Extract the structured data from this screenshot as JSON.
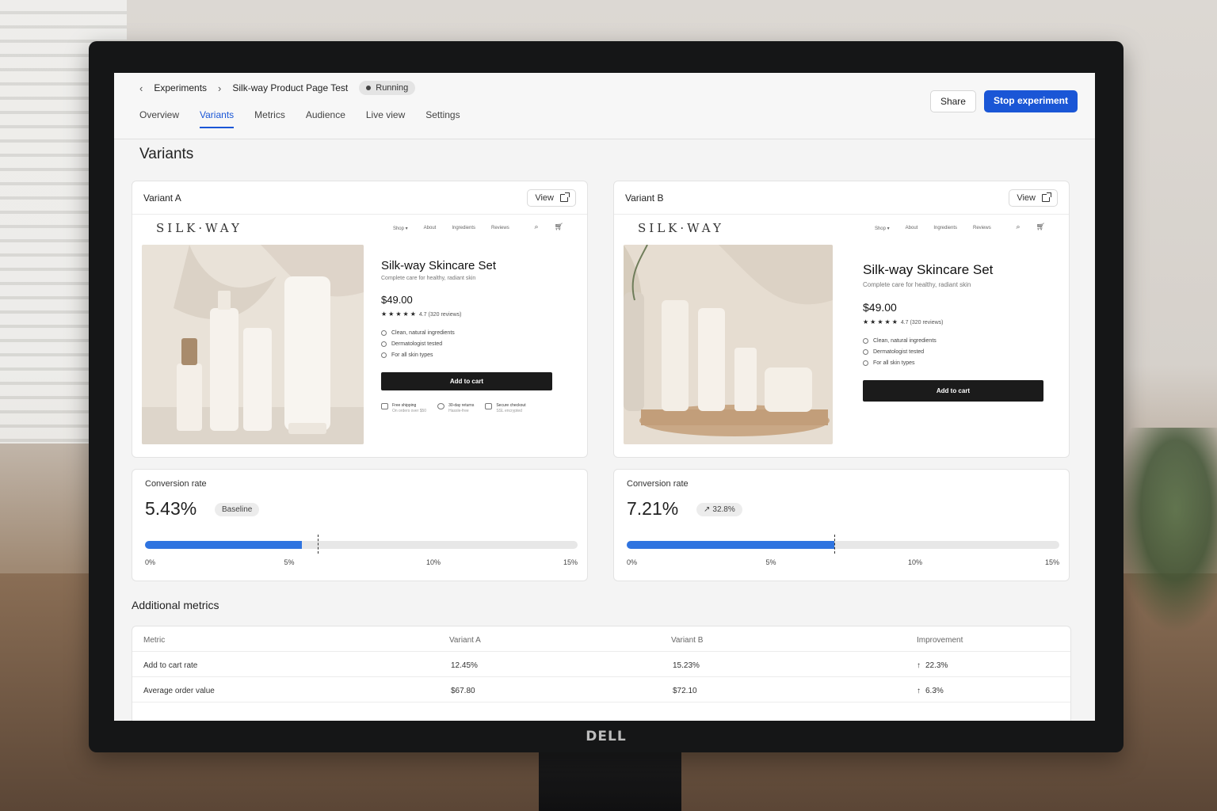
{
  "breadcrumb": {
    "parent": "Experiments",
    "current": "Silk-way Product Page Test",
    "status": "Running"
  },
  "tabs": [
    {
      "label": "Overview"
    },
    {
      "label": "Variants"
    },
    {
      "label": "Metrics"
    },
    {
      "label": "Audience"
    },
    {
      "label": "Live view"
    },
    {
      "label": "Settings"
    }
  ],
  "active_tab": "Variants",
  "actions": {
    "share": "Share",
    "stop": "Stop experiment"
  },
  "page_title": "Variants",
  "variants": [
    {
      "name": "Variant A",
      "view_label": "View",
      "site": {
        "logo": "SILK·WAY",
        "nav": [
          "Shop ▾",
          "About",
          "Ingredients",
          "Reviews"
        ],
        "product_title": "Silk-way Skincare Set",
        "product_subtitle": "Complete care for healthy, radiant skin",
        "price": "$49.00",
        "stars": "★★★★★",
        "rating": "4.7 (320 reviews)",
        "features": [
          "Clean, natural ingredients",
          "Dermatologist tested",
          "For all skin types"
        ],
        "cta": "Add to cart",
        "trust": [
          {
            "title": "Free shipping",
            "sub": "On orders over $50"
          },
          {
            "title": "30-day returns",
            "sub": "Hassle-free"
          },
          {
            "title": "Secure checkout",
            "sub": "SSL encrypted"
          }
        ]
      },
      "conversion": {
        "label": "Conversion rate",
        "value": "5.43%",
        "badge": "Baseline",
        "rate_percent": 5.43,
        "marker_percent": 6.0
      }
    },
    {
      "name": "Variant B",
      "view_label": "View",
      "site": {
        "logo": "SILK·WAY",
        "nav": [
          "Shop ▾",
          "About",
          "Ingredients",
          "Reviews"
        ],
        "product_title": "Silk-way Skincare Set",
        "product_subtitle": "Complete care for healthy, radiant skin",
        "price": "$49.00",
        "stars": "★★★★★",
        "rating": "4.7 (320 reviews)",
        "features": [
          "Clean, natural ingredients",
          "Dermatologist tested",
          "For all skin types"
        ],
        "cta": "Add to cart"
      },
      "conversion": {
        "label": "Conversion rate",
        "value": "7.21%",
        "badge": "32.8%",
        "badge_icon": "↗",
        "rate_percent": 7.21,
        "marker_percent": 7.21
      }
    }
  ],
  "axis": {
    "max_percent": 15,
    "ticks": [
      "0%",
      "5%",
      "10%",
      "15%"
    ]
  },
  "additional_metrics": {
    "title": "Additional metrics",
    "columns": [
      "Metric",
      "Variant A",
      "Variant B",
      "Improvement"
    ],
    "rows": [
      {
        "metric": "Add to cart rate",
        "a": "12.45%",
        "b": "15.23%",
        "improvement": "22.3%"
      },
      {
        "metric": "Average order value",
        "a": "$67.80",
        "b": "$72.10",
        "improvement": "6.3%"
      }
    ]
  },
  "monitor_brand": "DELL",
  "colors": {
    "accent": "#1a56d6",
    "bar_fill": "#2f74e0",
    "cta_dark": "#1b1b1b"
  }
}
